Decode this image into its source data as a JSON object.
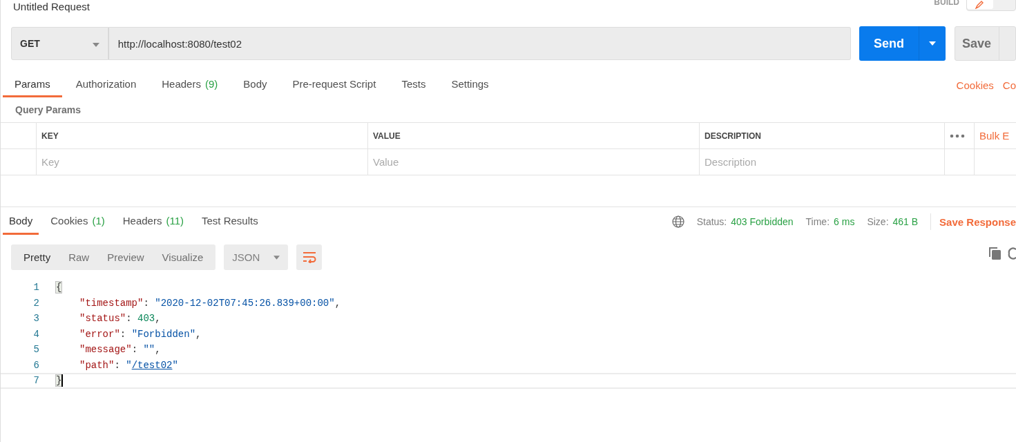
{
  "request": {
    "title": "Untitled Request",
    "mode": "BUILD",
    "method": "GET",
    "url": "http://localhost:8080/test02",
    "send_label": "Send",
    "save_label": "Save"
  },
  "request_tabs": [
    {
      "label": "Params",
      "selected": true
    },
    {
      "label": "Authorization",
      "selected": false
    },
    {
      "label": "Headers",
      "count": "(9)",
      "selected": false
    },
    {
      "label": "Body",
      "selected": false
    },
    {
      "label": "Pre-request Script",
      "selected": false
    },
    {
      "label": "Tests",
      "selected": false
    },
    {
      "label": "Settings",
      "selected": false
    }
  ],
  "request_links": [
    "Cookies",
    "Co"
  ],
  "query_params": {
    "title": "Query Params",
    "columns": [
      "KEY",
      "VALUE",
      "DESCRIPTION"
    ],
    "placeholders": [
      "Key",
      "Value",
      "Description"
    ],
    "bulk_edit": "Bulk E"
  },
  "response_tabs": [
    {
      "label": "Body",
      "selected": true
    },
    {
      "label": "Cookies",
      "count": "(1)",
      "selected": false
    },
    {
      "label": "Headers",
      "count": "(11)",
      "selected": false
    },
    {
      "label": "Test Results",
      "selected": false
    }
  ],
  "response_meta": {
    "status_label": "Status:",
    "status": "403 Forbidden",
    "time_label": "Time:",
    "time": "6 ms",
    "size_label": "Size:",
    "size": "461 B",
    "save": "Save Response"
  },
  "view_modes": [
    {
      "label": "Pretty",
      "selected": true
    },
    {
      "label": "Raw",
      "selected": false
    },
    {
      "label": "Preview",
      "selected": false
    },
    {
      "label": "Visualize",
      "selected": false
    }
  ],
  "format": "JSON",
  "code_lines": [
    {
      "number": "1",
      "indented": false,
      "active": false,
      "tokens": [
        {
          "kind": "brace",
          "text": "{"
        }
      ]
    },
    {
      "number": "2",
      "indented": true,
      "active": false,
      "tokens": [
        {
          "kind": "key",
          "text": "\"timestamp\""
        },
        {
          "kind": "punct",
          "text": ": "
        },
        {
          "kind": "string",
          "text": "\"2020-12-02T07:45:26.839+00:00\""
        },
        {
          "kind": "punct",
          "text": ","
        }
      ]
    },
    {
      "number": "3",
      "indented": true,
      "active": false,
      "tokens": [
        {
          "kind": "key",
          "text": "\"status\""
        },
        {
          "kind": "punct",
          "text": ": "
        },
        {
          "kind": "number",
          "text": "403"
        },
        {
          "kind": "punct",
          "text": ","
        }
      ]
    },
    {
      "number": "4",
      "indented": true,
      "active": false,
      "tokens": [
        {
          "kind": "key",
          "text": "\"error\""
        },
        {
          "kind": "punct",
          "text": ": "
        },
        {
          "kind": "string",
          "text": "\"Forbidden\""
        },
        {
          "kind": "punct",
          "text": ","
        }
      ]
    },
    {
      "number": "5",
      "indented": true,
      "active": false,
      "tokens": [
        {
          "kind": "key",
          "text": "\"message\""
        },
        {
          "kind": "punct",
          "text": ": "
        },
        {
          "kind": "string",
          "text": "\"\""
        },
        {
          "kind": "punct",
          "text": ","
        }
      ]
    },
    {
      "number": "6",
      "indented": true,
      "active": false,
      "tokens": [
        {
          "kind": "key",
          "text": "\"path\""
        },
        {
          "kind": "punct",
          "text": ": "
        },
        {
          "kind": "string",
          "text": "\""
        },
        {
          "kind": "link",
          "text": "/test02"
        },
        {
          "kind": "string",
          "text": "\""
        }
      ]
    },
    {
      "number": "7",
      "indented": false,
      "active": true,
      "tokens": [
        {
          "kind": "brace",
          "text": "}"
        }
      ]
    }
  ]
}
